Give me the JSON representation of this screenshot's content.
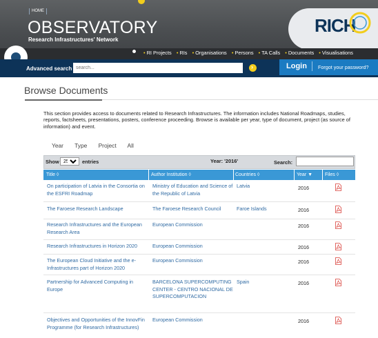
{
  "header": {
    "home_label": "HOME",
    "title": "OBSERVATORY",
    "subtitle": "Research Infrastructures' Network",
    "logo_text": "RICH",
    "nav_items": [
      "RI Projects",
      "RIs",
      "Organisations",
      "Persons",
      "TA Calls",
      "Documents",
      "Visualisations"
    ]
  },
  "search_bar": {
    "label": "Advanced search",
    "placeholder": "search...",
    "login_label": "Login",
    "forgot_label": "Forgot your password?"
  },
  "page": {
    "title": "Browse Documents",
    "intro": "This section provides access to documents related to Research Infrastructures. The information includes National Roadmaps, studies, reports, factsheets, presentations, posters, conference proceeding. Browse is available per year, type of document, project (as source of information) and event.",
    "browse_tabs": [
      "Year",
      "Type",
      "Project",
      "All"
    ]
  },
  "table": {
    "show_label": "Show",
    "entries_value": "25",
    "entries_label": "entries",
    "year_caption": "Year: '2016'",
    "search_label": "Search:",
    "columns": [
      "Title",
      "Author Institution",
      "Countries",
      "Year",
      "Files"
    ],
    "rows": [
      {
        "title": "On participation of Latvia in the Consortia on the ESFRI Roadmap",
        "institution": "Ministry of Education and Science of the Republic of Latvia",
        "country": "Latvia",
        "year": "2016"
      },
      {
        "title": "The Faroese Research Landscape",
        "institution": "The Faroese Research Council",
        "country": "Faroe Islands",
        "year": "2016"
      },
      {
        "title": "Research Infrastructures and the European Research Area",
        "institution": "European Commission",
        "country": "",
        "year": "2016"
      },
      {
        "title": "Research Infrastructures in Horizon 2020",
        "institution": "European Commission",
        "country": "",
        "year": "2016"
      },
      {
        "title": "The European Cloud Initiative and the e-Infrastructures part of Horizon 2020",
        "institution": "European Commission",
        "country": "",
        "year": "2016"
      },
      {
        "title": "Partnership for Advanced Computing in Europe",
        "institution": "BARCELONA SUPERCOMPUTING CENTER - CENTRO NACIONAL DE SUPERCOMPUTACION",
        "country": "Spain",
        "year": "2016"
      },
      {
        "title": "Objectives and Opportunities of the InnovFin Programme (for Research Infrastructures)",
        "institution": "European Commission",
        "country": "",
        "year": "2016"
      }
    ]
  },
  "icons": {
    "file": "pdf-icon",
    "sort": "sort-arrow-icon",
    "dropdown": "chevron-down-icon"
  },
  "colors": {
    "header_bg": "#4a4d50",
    "search_bar_bg": "#0d3358",
    "login_bg": "#1b7bc2",
    "accent_yellow": "#f2cd1c",
    "table_header_bg": "#3a98d6",
    "link": "#2f6aa3"
  }
}
